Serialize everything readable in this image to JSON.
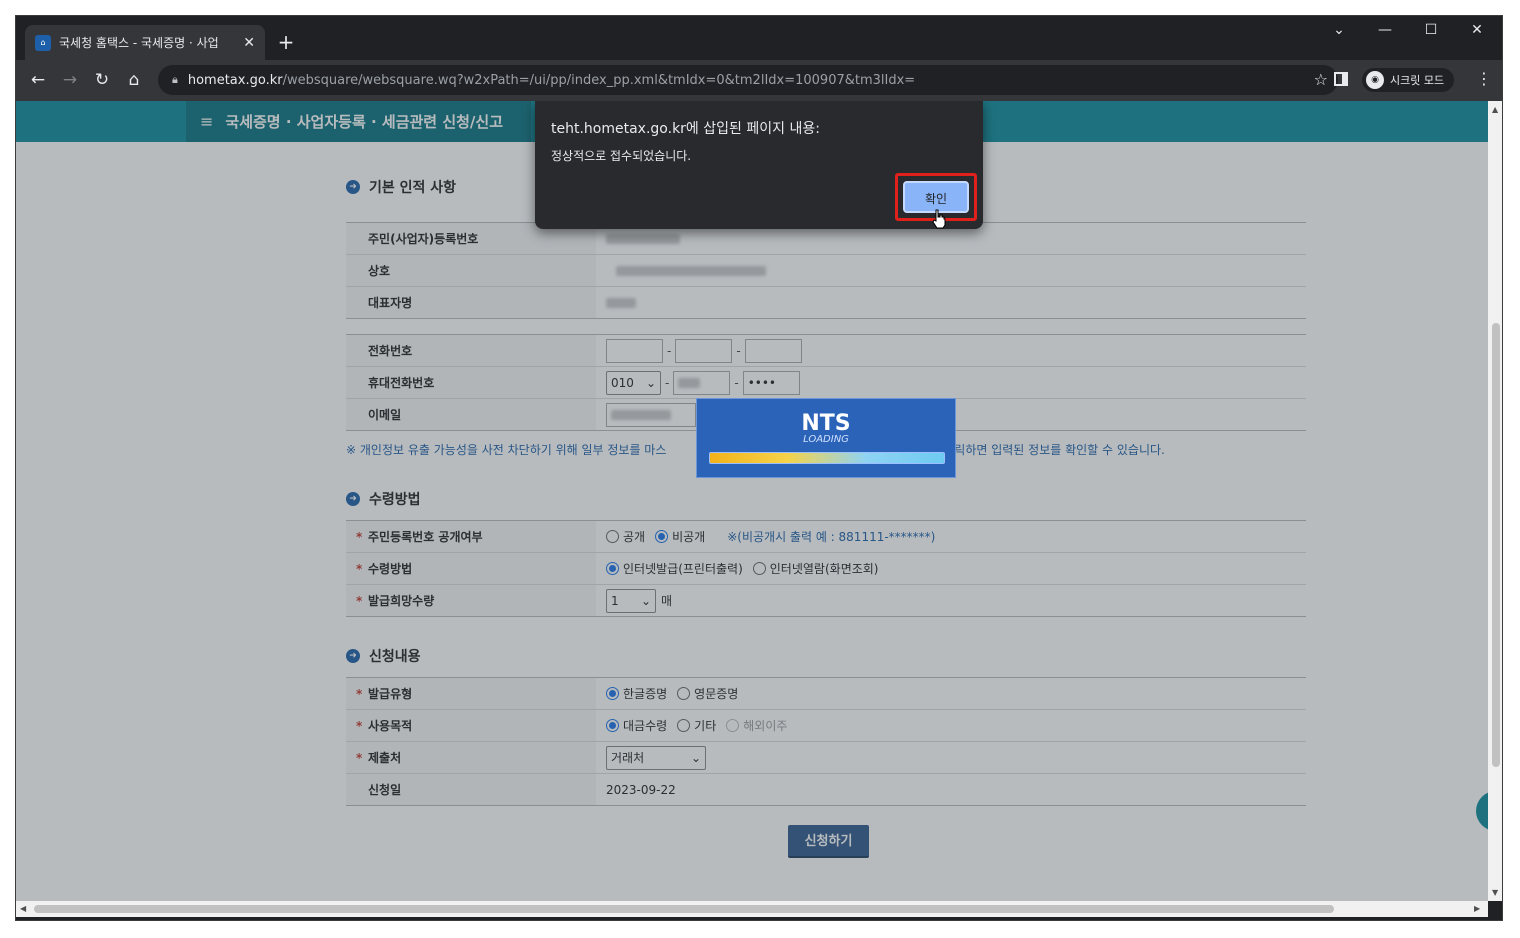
{
  "browser": {
    "tab_title": "국세청 홈택스 - 국세증명 · 사업",
    "url_host": "hometax.go.kr",
    "url_rest": "/websquare/websquare.wq?w2xPath=/ui/pp/index_pp.xml&tmIdx=0&tm2lIdx=100907&tm3lIdx=",
    "incognito_label": "시크릿 모드",
    "new_tab": "+",
    "icons": [
      "back-icon",
      "forward-icon",
      "reload-icon",
      "home-icon",
      "lock-icon",
      "star-icon",
      "side-panel-icon",
      "incognito-icon",
      "menu-icon"
    ]
  },
  "page": {
    "topbar_title": "국세증명 · 사업자등록 · 세금관련 신청/신고",
    "section1_title": "기본 인적 사항",
    "basic": {
      "id_label": "주민(사업자)등록번호",
      "name_label": "상호",
      "rep_label": "대표자명"
    },
    "contact": {
      "phone_label": "전화번호",
      "mobile_label": "휴대전화번호",
      "mobile_prefix": "010",
      "mobile_last": "••••",
      "email_label": "이메일"
    },
    "note_left": "※ 개인정보 유출 가능성을 사전 차단하기 위해 일부 정보를 마스",
    "note_right": "로 클릭하면 입력된 정보를 확인할 수 있습니다.",
    "section2_title": "수령방법",
    "receive": {
      "disclose_label": "주민등록번호 공개여부",
      "disclose_opt1": "공개",
      "disclose_opt2": "비공개",
      "disclose_hint": "※(비공개시 출력 예 : 881111-*******)",
      "method_label": "수령방법",
      "method_opt1": "인터넷발급(프린터출력)",
      "method_opt2": "인터넷열람(화면조회)",
      "qty_label": "발급희망수량",
      "qty_value": "1",
      "qty_unit": "매"
    },
    "section3_title": "신청내용",
    "apply": {
      "type_label": "발급유형",
      "type_opt1": "한글증명",
      "type_opt2": "영문증명",
      "purpose_label": "사용목적",
      "purpose_opt1": "대금수령",
      "purpose_opt2": "기타",
      "purpose_opt3": "해외이주",
      "submit_to_label": "제출처",
      "submit_to_value": "거래처",
      "date_label": "신청일",
      "date_value": "2023-09-22"
    },
    "submit_button": "신청하기",
    "required_mark": "*"
  },
  "loading": {
    "brand": "NTS",
    "text": "LOADING",
    "progress": 1.0
  },
  "dialog": {
    "title": "teht.hometax.go.kr에 삽입된 페이지 내용:",
    "message": "정상적으로 접수되었습니다.",
    "ok_label": "확인"
  }
}
